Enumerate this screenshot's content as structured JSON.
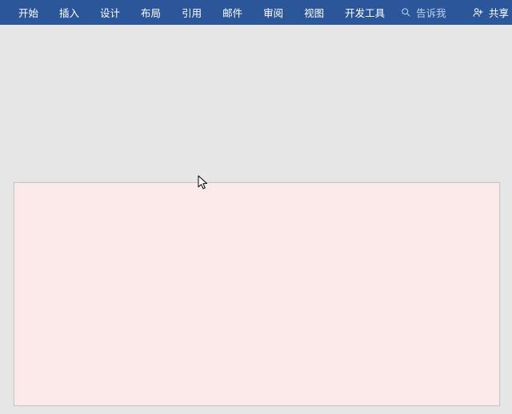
{
  "ribbon": {
    "tabs": [
      {
        "label": "开始"
      },
      {
        "label": "插入"
      },
      {
        "label": "设计"
      },
      {
        "label": "布局"
      },
      {
        "label": "引用"
      },
      {
        "label": "邮件"
      },
      {
        "label": "审阅"
      },
      {
        "label": "视图"
      },
      {
        "label": "开发工具"
      }
    ],
    "tell_me_placeholder": "告诉我",
    "share_label": "共享"
  }
}
